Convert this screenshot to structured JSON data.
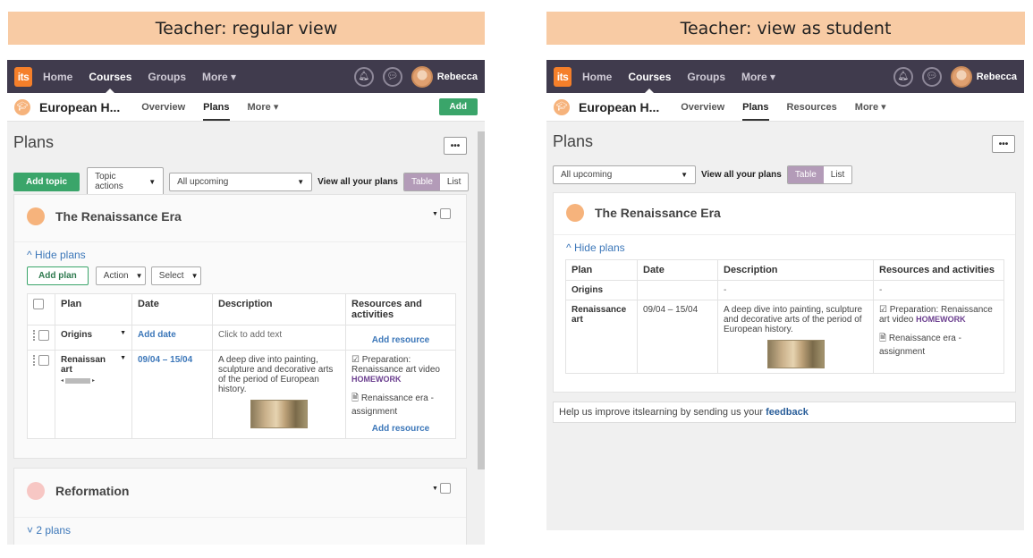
{
  "captions": {
    "left": "Teacher: regular view",
    "right": "Teacher: view as student"
  },
  "topbar": {
    "logo": "its",
    "nav": [
      {
        "label": "Home"
      },
      {
        "label": "Courses"
      },
      {
        "label": "Groups"
      },
      {
        "label": "More ▾"
      }
    ],
    "user": "Rebecca"
  },
  "course": {
    "title": "European H...",
    "teacher_tabs": [
      "Overview",
      "Plans",
      "More ▾"
    ],
    "student_tabs": [
      "Overview",
      "Plans",
      "Resources",
      "More ▾"
    ],
    "add_label": "Add"
  },
  "page": {
    "heading": "Plans",
    "more_label": "•••",
    "add_topic": "Add topic",
    "topic_actions": "Topic actions",
    "filter": "All upcoming",
    "view_all": "View all your plans",
    "view_table": "Table",
    "view_list": "List"
  },
  "topic1": {
    "title": "The Renaissance Era",
    "hide_plans": "^ Hide plans",
    "add_plan": "Add plan",
    "action": "Action",
    "select": "Select",
    "columns": {
      "plan": "Plan",
      "date": "Date",
      "description": "Description",
      "resources": "Resources and activities"
    },
    "rows": [
      {
        "plan": "Origins",
        "date": "Add date",
        "date_student": "",
        "description": "Click to add text",
        "description_student": "-",
        "resource_link": "Add resource",
        "resource_student": "-"
      },
      {
        "plan": "Renaissance art",
        "plan_trunc": "Renaissan",
        "plan_trunc2": "art",
        "date": "09/04 – 15/04",
        "description": "A deep dive into painting, sculpture and decorative arts of the period of European history.",
        "res1": "Preparation: Renaissance art video",
        "res1_badge": "HOMEWORK",
        "res2": "Renaissance era - assignment",
        "resource_link": "Add resource"
      }
    ]
  },
  "topic2": {
    "title": "Reformation",
    "plans_toggle": "˅ 2 plans"
  },
  "feedback": {
    "text": "Help us improve itslearning by sending us your ",
    "link": "feedback"
  },
  "colors": {
    "topbar": "#403b4d",
    "accent_green": "#3aa56a",
    "caption_bg": "#f8cba4",
    "dot_orange": "#f6b37c",
    "dot_pink": "#f7c7c4",
    "link": "#3c77b9"
  }
}
